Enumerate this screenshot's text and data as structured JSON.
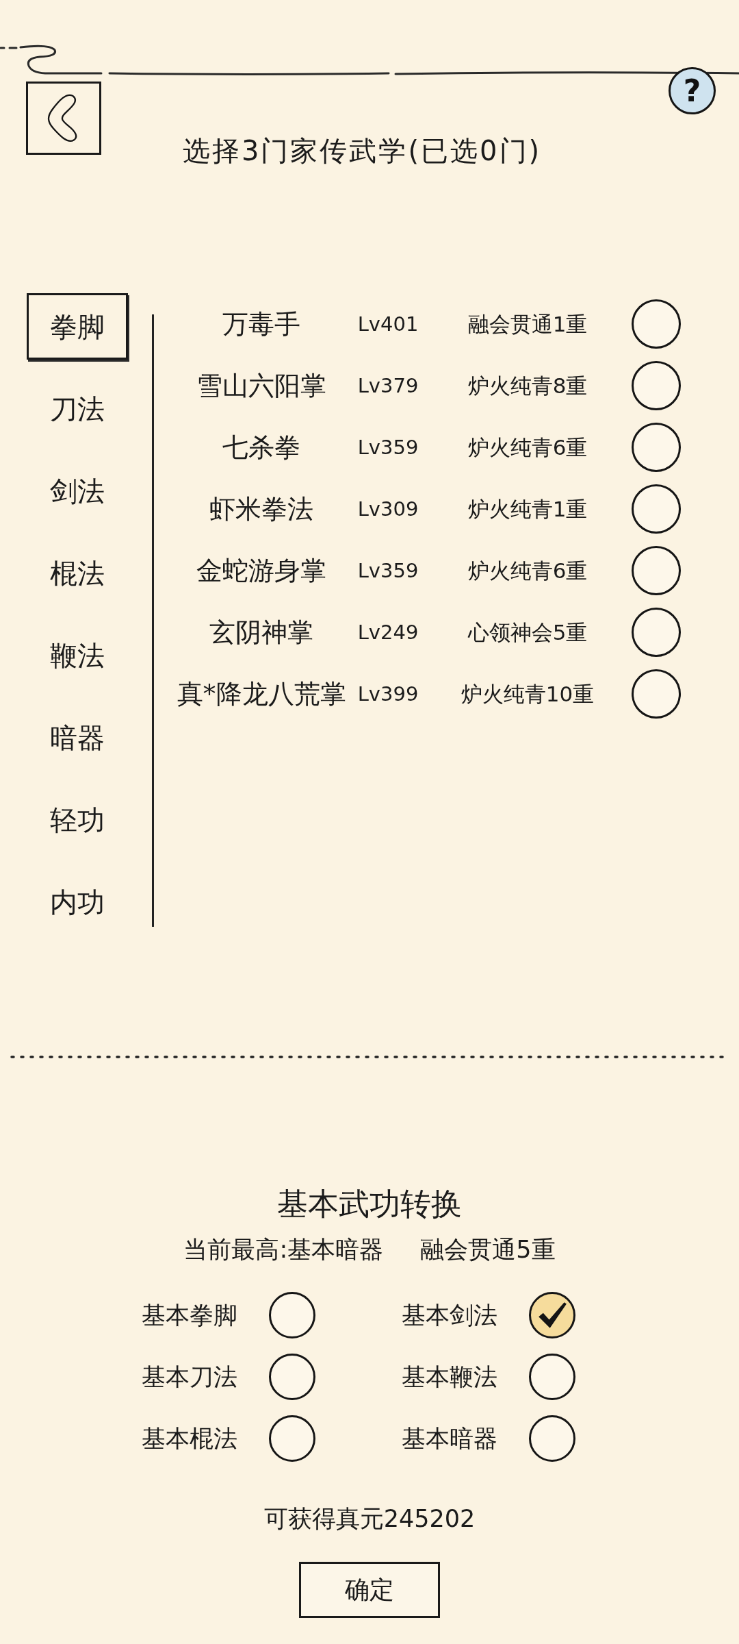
{
  "header": {
    "help": "?",
    "title": "选择3门家传武学(已选0门)"
  },
  "categories": [
    {
      "label": "拳脚",
      "selected": true
    },
    {
      "label": "刀法",
      "selected": false
    },
    {
      "label": "剑法",
      "selected": false
    },
    {
      "label": "棍法",
      "selected": false
    },
    {
      "label": "鞭法",
      "selected": false
    },
    {
      "label": "暗器",
      "selected": false
    },
    {
      "label": "轻功",
      "selected": false
    },
    {
      "label": "内功",
      "selected": false
    }
  ],
  "skills": [
    {
      "name": "万毒手",
      "lv": "Lv401",
      "realm": "融会贯通1重",
      "selected": false
    },
    {
      "name": "雪山六阳掌",
      "lv": "Lv379",
      "realm": "炉火纯青8重",
      "selected": false
    },
    {
      "name": "七杀拳",
      "lv": "Lv359",
      "realm": "炉火纯青6重",
      "selected": false
    },
    {
      "name": "虾米拳法",
      "lv": "Lv309",
      "realm": "炉火纯青1重",
      "selected": false
    },
    {
      "name": "金蛇游身掌",
      "lv": "Lv359",
      "realm": "炉火纯青6重",
      "selected": false
    },
    {
      "name": "玄阴神掌",
      "lv": "Lv249",
      "realm": "心领神会5重",
      "selected": false
    },
    {
      "name": "真*降龙八荒掌",
      "lv": "Lv399",
      "realm": "炉火纯青10重",
      "selected": false
    }
  ],
  "conversion": {
    "title": "基本武功转换",
    "current_best": "当前最高:基本暗器",
    "current_realm": "融会贯通5重",
    "options": [
      {
        "label": "基本拳脚",
        "selected": false
      },
      {
        "label": "基本剑法",
        "selected": true
      },
      {
        "label": "基本刀法",
        "selected": false
      },
      {
        "label": "基本鞭法",
        "selected": false
      },
      {
        "label": "基本棍法",
        "selected": false
      },
      {
        "label": "基本暗器",
        "selected": false
      }
    ],
    "reward": "可获得真元245202",
    "confirm_button": "确定"
  }
}
